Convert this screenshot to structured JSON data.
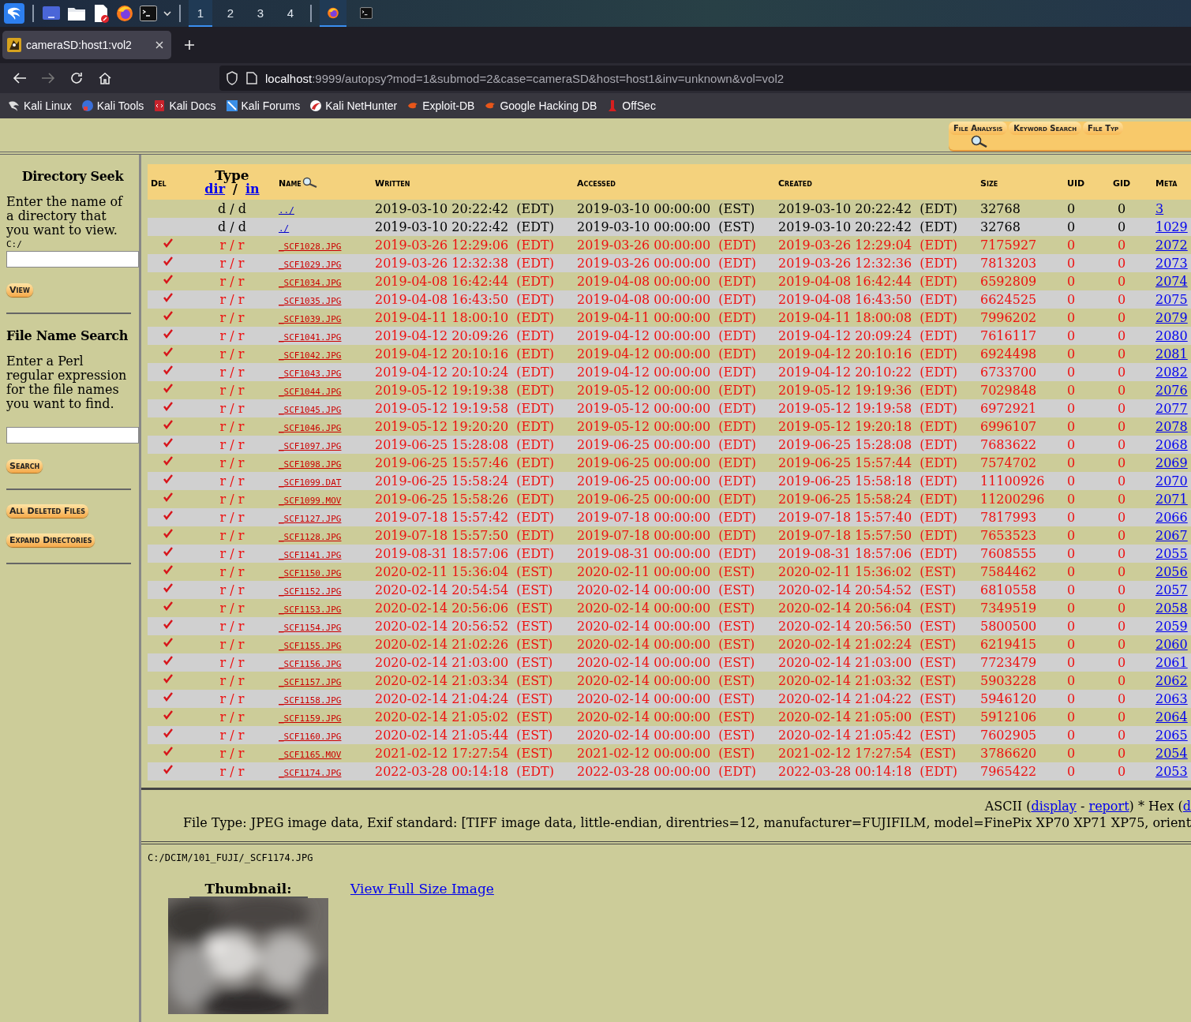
{
  "taskbar": {
    "workspaces": [
      {
        "label": "1",
        "selected": true
      },
      {
        "label": "2",
        "selected": false
      },
      {
        "label": "3",
        "selected": false
      },
      {
        "label": "4",
        "selected": false
      }
    ],
    "windows": [
      {
        "kind": "firefox",
        "selected": true
      },
      {
        "kind": "terminal",
        "selected": false
      }
    ]
  },
  "browser": {
    "tabs": [
      {
        "title": "cameraSD:host1:vol2",
        "selected": true
      }
    ],
    "url": {
      "host": "localhost",
      "rest": ":9999/autopsy?mod=1&submod=2&case=cameraSD&host=host1&inv=unknown&vol=vol2"
    },
    "forward_disabled": true,
    "bookmarks": [
      {
        "label": "Kali Linux",
        "kind": "kali"
      },
      {
        "label": "Kali Tools",
        "kind": "tools"
      },
      {
        "label": "Kali Docs",
        "kind": "docs"
      },
      {
        "label": "Kali Forums",
        "kind": "forums"
      },
      {
        "label": "Kali NetHunter",
        "kind": "nethunter"
      },
      {
        "label": "Exploit-DB",
        "kind": "exploit"
      },
      {
        "label": "Google Hacking DB",
        "kind": "exploit"
      },
      {
        "label": "OffSec",
        "kind": "offsec"
      }
    ]
  },
  "mode_tabs": [
    {
      "label": "File Analysis",
      "selected": true
    },
    {
      "label": "Keyword Search",
      "selected": false
    },
    {
      "label": "File Typ",
      "selected": false
    }
  ],
  "sidebar": {
    "dir_title": "Directory Seek",
    "dir_text": "Enter the name of a directory that you want to view.",
    "dir_prefix": "C:/",
    "view_button": "View",
    "search_title": "File Name Search",
    "search_text": "Enter a Perl regular expression for the file names you want to find.",
    "search_button": "Search",
    "buttons": [
      "All Deleted Files",
      "Expand Directories"
    ]
  },
  "table": {
    "columns": {
      "del": "Del",
      "type": "Type",
      "type_links": [
        "dir",
        "in"
      ],
      "type_sep": "/",
      "name": "Name",
      "written": "Written",
      "accessed": "Accessed",
      "created": "Created",
      "size": "Size",
      "uid": "UID",
      "gid": "GID",
      "meta": "Meta"
    },
    "rows": [
      {
        "deleted": false,
        "type": "d / d",
        "name": "../",
        "written": "2019-03-10 20:22:42  (EDT)",
        "accessed": "2019-03-10 00:00:00  (EST)",
        "created": "2019-03-10 20:22:42  (EDT)",
        "size": "32768",
        "uid": "0",
        "gid": "0",
        "meta": "3"
      },
      {
        "deleted": false,
        "type": "d / d",
        "name": "./",
        "written": "2019-03-10 20:22:42  (EDT)",
        "accessed": "2019-03-10 00:00:00  (EST)",
        "created": "2019-03-10 20:22:42  (EDT)",
        "size": "32768",
        "uid": "0",
        "gid": "0",
        "meta": "1029"
      },
      {
        "deleted": true,
        "type": "r / r",
        "name": "_SCF1028.JPG",
        "written": "2019-03-26 12:29:06  (EDT)",
        "accessed": "2019-03-26 00:00:00  (EDT)",
        "created": "2019-03-26 12:29:04  (EDT)",
        "size": "7175927",
        "uid": "0",
        "gid": "0",
        "meta": "2072"
      },
      {
        "deleted": true,
        "type": "r / r",
        "name": "_SCF1029.JPG",
        "written": "2019-03-26 12:32:38  (EDT)",
        "accessed": "2019-03-26 00:00:00  (EDT)",
        "created": "2019-03-26 12:32:36  (EDT)",
        "size": "7813203",
        "uid": "0",
        "gid": "0",
        "meta": "2073"
      },
      {
        "deleted": true,
        "type": "r / r",
        "name": "_SCF1034.JPG",
        "written": "2019-04-08 16:42:44  (EDT)",
        "accessed": "2019-04-08 00:00:00  (EDT)",
        "created": "2019-04-08 16:42:44  (EDT)",
        "size": "6592809",
        "uid": "0",
        "gid": "0",
        "meta": "2074"
      },
      {
        "deleted": true,
        "type": "r / r",
        "name": "_SCF1035.JPG",
        "written": "2019-04-08 16:43:50  (EDT)",
        "accessed": "2019-04-08 00:00:00  (EDT)",
        "created": "2019-04-08 16:43:50  (EDT)",
        "size": "6624525",
        "uid": "0",
        "gid": "0",
        "meta": "2075"
      },
      {
        "deleted": true,
        "type": "r / r",
        "name": "_SCF1039.JPG",
        "written": "2019-04-11 18:00:10  (EDT)",
        "accessed": "2019-04-11 00:00:00  (EDT)",
        "created": "2019-04-11 18:00:08  (EDT)",
        "size": "7996202",
        "uid": "0",
        "gid": "0",
        "meta": "2079"
      },
      {
        "deleted": true,
        "type": "r / r",
        "name": "_SCF1041.JPG",
        "written": "2019-04-12 20:09:26  (EDT)",
        "accessed": "2019-04-12 00:00:00  (EDT)",
        "created": "2019-04-12 20:09:24  (EDT)",
        "size": "7616117",
        "uid": "0",
        "gid": "0",
        "meta": "2080"
      },
      {
        "deleted": true,
        "type": "r / r",
        "name": "_SCF1042.JPG",
        "written": "2019-04-12 20:10:16  (EDT)",
        "accessed": "2019-04-12 00:00:00  (EDT)",
        "created": "2019-04-12 20:10:16  (EDT)",
        "size": "6924498",
        "uid": "0",
        "gid": "0",
        "meta": "2081"
      },
      {
        "deleted": true,
        "type": "r / r",
        "name": "_SCF1043.JPG",
        "written": "2019-04-12 20:10:24  (EDT)",
        "accessed": "2019-04-12 00:00:00  (EDT)",
        "created": "2019-04-12 20:10:22  (EDT)",
        "size": "6733700",
        "uid": "0",
        "gid": "0",
        "meta": "2082"
      },
      {
        "deleted": true,
        "type": "r / r",
        "name": "_SCF1044.JPG",
        "written": "2019-05-12 19:19:38  (EDT)",
        "accessed": "2019-05-12 00:00:00  (EDT)",
        "created": "2019-05-12 19:19:36  (EDT)",
        "size": "7029848",
        "uid": "0",
        "gid": "0",
        "meta": "2076"
      },
      {
        "deleted": true,
        "type": "r / r",
        "name": "_SCF1045.JPG",
        "written": "2019-05-12 19:19:58  (EDT)",
        "accessed": "2019-05-12 00:00:00  (EDT)",
        "created": "2019-05-12 19:19:58  (EDT)",
        "size": "6972921",
        "uid": "0",
        "gid": "0",
        "meta": "2077"
      },
      {
        "deleted": true,
        "type": "r / r",
        "name": "_SCF1046.JPG",
        "written": "2019-05-12 19:20:20  (EDT)",
        "accessed": "2019-05-12 00:00:00  (EDT)",
        "created": "2019-05-12 19:20:18  (EDT)",
        "size": "6996107",
        "uid": "0",
        "gid": "0",
        "meta": "2078"
      },
      {
        "deleted": true,
        "type": "r / r",
        "name": "_SCF1097.JPG",
        "written": "2019-06-25 15:28:08  (EDT)",
        "accessed": "2019-06-25 00:00:00  (EDT)",
        "created": "2019-06-25 15:28:08  (EDT)",
        "size": "7683622",
        "uid": "0",
        "gid": "0",
        "meta": "2068"
      },
      {
        "deleted": true,
        "type": "r / r",
        "name": "_SCF1098.JPG",
        "written": "2019-06-25 15:57:46  (EDT)",
        "accessed": "2019-06-25 00:00:00  (EDT)",
        "created": "2019-06-25 15:57:44  (EDT)",
        "size": "7574702",
        "uid": "0",
        "gid": "0",
        "meta": "2069"
      },
      {
        "deleted": true,
        "type": "r / r",
        "name": "_SCF1099.DAT",
        "written": "2019-06-25 15:58:24  (EDT)",
        "accessed": "2019-06-25 00:00:00  (EDT)",
        "created": "2019-06-25 15:58:18  (EDT)",
        "size": "11100926",
        "uid": "0",
        "gid": "0",
        "meta": "2070"
      },
      {
        "deleted": true,
        "type": "r / r",
        "name": "_SCF1099.MOV",
        "written": "2019-06-25 15:58:26  (EDT)",
        "accessed": "2019-06-25 00:00:00  (EDT)",
        "created": "2019-06-25 15:58:24  (EDT)",
        "size": "11200296",
        "uid": "0",
        "gid": "0",
        "meta": "2071"
      },
      {
        "deleted": true,
        "type": "r / r",
        "name": "_SCF1127.JPG",
        "written": "2019-07-18 15:57:42  (EDT)",
        "accessed": "2019-07-18 00:00:00  (EDT)",
        "created": "2019-07-18 15:57:40  (EDT)",
        "size": "7817993",
        "uid": "0",
        "gid": "0",
        "meta": "2066"
      },
      {
        "deleted": true,
        "type": "r / r",
        "name": "_SCF1128.JPG",
        "written": "2019-07-18 15:57:50  (EDT)",
        "accessed": "2019-07-18 00:00:00  (EDT)",
        "created": "2019-07-18 15:57:50  (EDT)",
        "size": "7653523",
        "uid": "0",
        "gid": "0",
        "meta": "2067"
      },
      {
        "deleted": true,
        "type": "r / r",
        "name": "_SCF1141.JPG",
        "written": "2019-08-31 18:57:06  (EDT)",
        "accessed": "2019-08-31 00:00:00  (EDT)",
        "created": "2019-08-31 18:57:06  (EDT)",
        "size": "7608555",
        "uid": "0",
        "gid": "0",
        "meta": "2055"
      },
      {
        "deleted": true,
        "type": "r / r",
        "name": "_SCF1150.JPG",
        "written": "2020-02-11 15:36:04  (EST)",
        "accessed": "2020-02-11 00:00:00  (EST)",
        "created": "2020-02-11 15:36:02  (EST)",
        "size": "7584462",
        "uid": "0",
        "gid": "0",
        "meta": "2056"
      },
      {
        "deleted": true,
        "type": "r / r",
        "name": "_SCF1152.JPG",
        "written": "2020-02-14 20:54:54  (EST)",
        "accessed": "2020-02-14 00:00:00  (EST)",
        "created": "2020-02-14 20:54:52  (EST)",
        "size": "6810558",
        "uid": "0",
        "gid": "0",
        "meta": "2057"
      },
      {
        "deleted": true,
        "type": "r / r",
        "name": "_SCF1153.JPG",
        "written": "2020-02-14 20:56:06  (EST)",
        "accessed": "2020-02-14 00:00:00  (EST)",
        "created": "2020-02-14 20:56:04  (EST)",
        "size": "7349519",
        "uid": "0",
        "gid": "0",
        "meta": "2058"
      },
      {
        "deleted": true,
        "type": "r / r",
        "name": "_SCF1154.JPG",
        "written": "2020-02-14 20:56:52  (EST)",
        "accessed": "2020-02-14 00:00:00  (EST)",
        "created": "2020-02-14 20:56:50  (EST)",
        "size": "5800500",
        "uid": "0",
        "gid": "0",
        "meta": "2059"
      },
      {
        "deleted": true,
        "type": "r / r",
        "name": "_SCF1155.JPG",
        "written": "2020-02-14 21:02:26  (EST)",
        "accessed": "2020-02-14 00:00:00  (EST)",
        "created": "2020-02-14 21:02:24  (EST)",
        "size": "6219415",
        "uid": "0",
        "gid": "0",
        "meta": "2060"
      },
      {
        "deleted": true,
        "type": "r / r",
        "name": "_SCF1156.JPG",
        "written": "2020-02-14 21:03:00  (EST)",
        "accessed": "2020-02-14 00:00:00  (EST)",
        "created": "2020-02-14 21:03:00  (EST)",
        "size": "7723479",
        "uid": "0",
        "gid": "0",
        "meta": "2061"
      },
      {
        "deleted": true,
        "type": "r / r",
        "name": "_SCF1157.JPG",
        "written": "2020-02-14 21:03:34  (EST)",
        "accessed": "2020-02-14 00:00:00  (EST)",
        "created": "2020-02-14 21:03:32  (EST)",
        "size": "5903228",
        "uid": "0",
        "gid": "0",
        "meta": "2062"
      },
      {
        "deleted": true,
        "type": "r / r",
        "name": "_SCF1158.JPG",
        "written": "2020-02-14 21:04:24  (EST)",
        "accessed": "2020-02-14 00:00:00  (EST)",
        "created": "2020-02-14 21:04:22  (EST)",
        "size": "5946120",
        "uid": "0",
        "gid": "0",
        "meta": "2063"
      },
      {
        "deleted": true,
        "type": "r / r",
        "name": "_SCF1159.JPG",
        "written": "2020-02-14 21:05:02  (EST)",
        "accessed": "2020-02-14 00:00:00  (EST)",
        "created": "2020-02-14 21:05:00  (EST)",
        "size": "5912106",
        "uid": "0",
        "gid": "0",
        "meta": "2064"
      },
      {
        "deleted": true,
        "type": "r / r",
        "name": "_SCF1160.JPG",
        "written": "2020-02-14 21:05:44  (EST)",
        "accessed": "2020-02-14 00:00:00  (EST)",
        "created": "2020-02-14 21:05:42  (EST)",
        "size": "7602905",
        "uid": "0",
        "gid": "0",
        "meta": "2065"
      },
      {
        "deleted": true,
        "type": "r / r",
        "name": "_SCF1165.MOV",
        "written": "2021-02-12 17:27:54  (EST)",
        "accessed": "2021-02-12 00:00:00  (EST)",
        "created": "2021-02-12 17:27:54  (EST)",
        "size": "3786620",
        "uid": "0",
        "gid": "0",
        "meta": "2054"
      },
      {
        "deleted": true,
        "type": "r / r",
        "name": "_SCF1174.JPG",
        "written": "2022-03-28 00:14:18  (EDT)",
        "accessed": "2022-03-28 00:00:00  (EDT)",
        "created": "2022-03-28 00:14:18  (EDT)",
        "size": "7965422",
        "uid": "0",
        "gid": "0",
        "meta": "2053"
      }
    ]
  },
  "detail": {
    "view_line": [
      {
        "kind": "text",
        "text": "ASCII ("
      },
      {
        "kind": "link",
        "text": "display"
      },
      {
        "kind": "text",
        "text": " - "
      },
      {
        "kind": "link",
        "text": "report"
      },
      {
        "kind": "text",
        "text": ") * Hex ("
      },
      {
        "kind": "link",
        "text": "d"
      }
    ],
    "file_type": "File Type: JPEG image data, Exif standard: [TIFF image data, little-endian, direntries=12, manufacturer=FUJIFILM, model=FinePix XP70 XP71 XP75, orient"
  },
  "preview": {
    "path": "C:/DCIM/101_FUJI/_SCF1174.JPG",
    "thumbnail_label": "Thumbnail:",
    "full_size_link": "View Full Size Image"
  }
}
